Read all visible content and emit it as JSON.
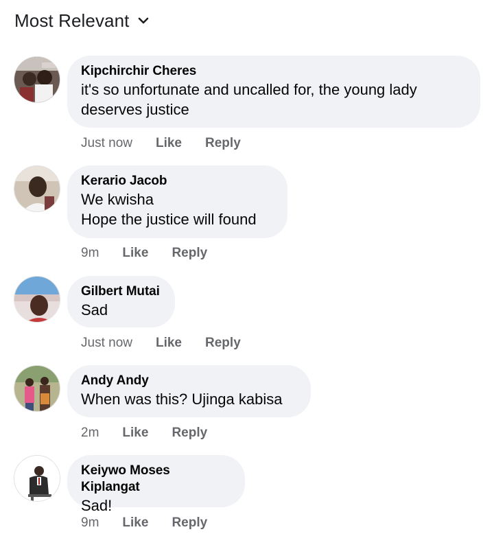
{
  "sort": {
    "label": "Most Relevant",
    "icon": "chevron-down-icon"
  },
  "colors": {
    "bubble": "#f0f2f5",
    "meta": "#65676b",
    "text": "#050505"
  },
  "comments": [
    {
      "author": "Kipchirchir Cheres",
      "text": "it's so unfortunate and uncalled for, the young lady\ndeserves justice",
      "time": "Just now",
      "like": "Like",
      "reply": "Reply"
    },
    {
      "author": "Kerario Jacob",
      "text": "We kwisha\nHope the justice will found",
      "time": "9m",
      "like": "Like",
      "reply": "Reply"
    },
    {
      "author": "Gilbert Mutai",
      "text": "Sad",
      "time": "Just now",
      "like": "Like",
      "reply": "Reply"
    },
    {
      "author": "Andy Andy",
      "text": "When was this? Ujinga kabisa",
      "time": "2m",
      "like": "Like",
      "reply": "Reply"
    },
    {
      "author": "Keiywo Moses Kiplangat",
      "text": "Sad!",
      "time": "9m",
      "like": "Like",
      "reply": "Reply"
    }
  ]
}
